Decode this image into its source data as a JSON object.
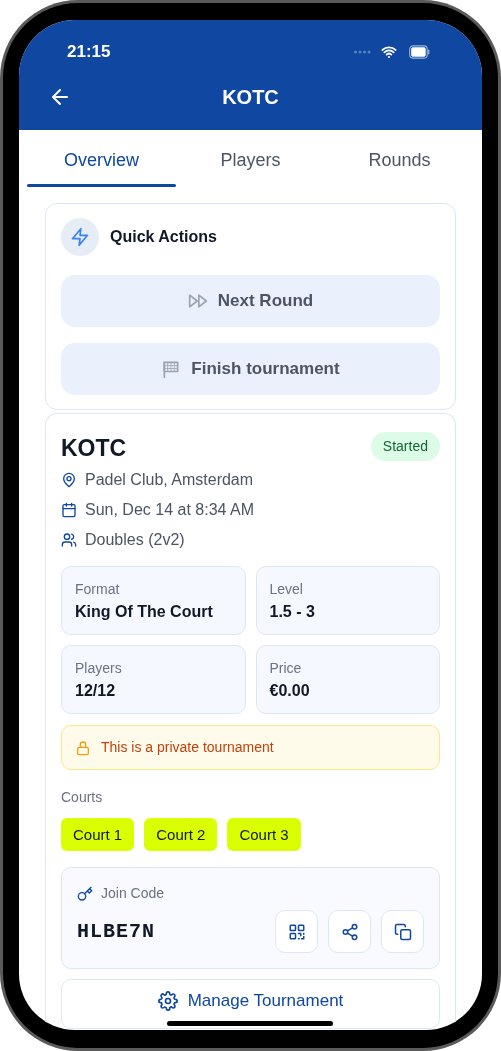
{
  "status_bar": {
    "time": "21:15"
  },
  "header": {
    "title": "KOTC"
  },
  "tabs": [
    {
      "label": "Overview",
      "selected": true
    },
    {
      "label": "Players",
      "selected": false
    },
    {
      "label": "Rounds",
      "selected": false
    }
  ],
  "quick_actions": {
    "title": "Quick Actions",
    "buttons": [
      {
        "kind": "next",
        "label": "Next Round"
      },
      {
        "kind": "finish",
        "label": "Finish tournament"
      }
    ]
  },
  "tournament": {
    "name": "KOTC",
    "status": "Started",
    "details": [
      {
        "kind": "location",
        "text": "Padel Club, Amsterdam"
      },
      {
        "kind": "date",
        "text": "Sun, Dec 14 at 8:34 AM"
      },
      {
        "kind": "players",
        "text": "Doubles (2v2)"
      }
    ],
    "stats": [
      {
        "label": "Format",
        "value": "King Of The Court"
      },
      {
        "label": "Level",
        "value": "1.5 - 3"
      },
      {
        "label": "Players",
        "value": "12/12"
      },
      {
        "label": "Price",
        "value": "€0.00"
      }
    ],
    "notice": "This is a private tournament",
    "courts_label": "Courts",
    "courts": [
      "Court 1",
      "Court 2",
      "Court 3"
    ],
    "join_code": {
      "label": "Join Code",
      "code": "HLBE7N"
    },
    "manage_button": "Manage Tournament"
  }
}
